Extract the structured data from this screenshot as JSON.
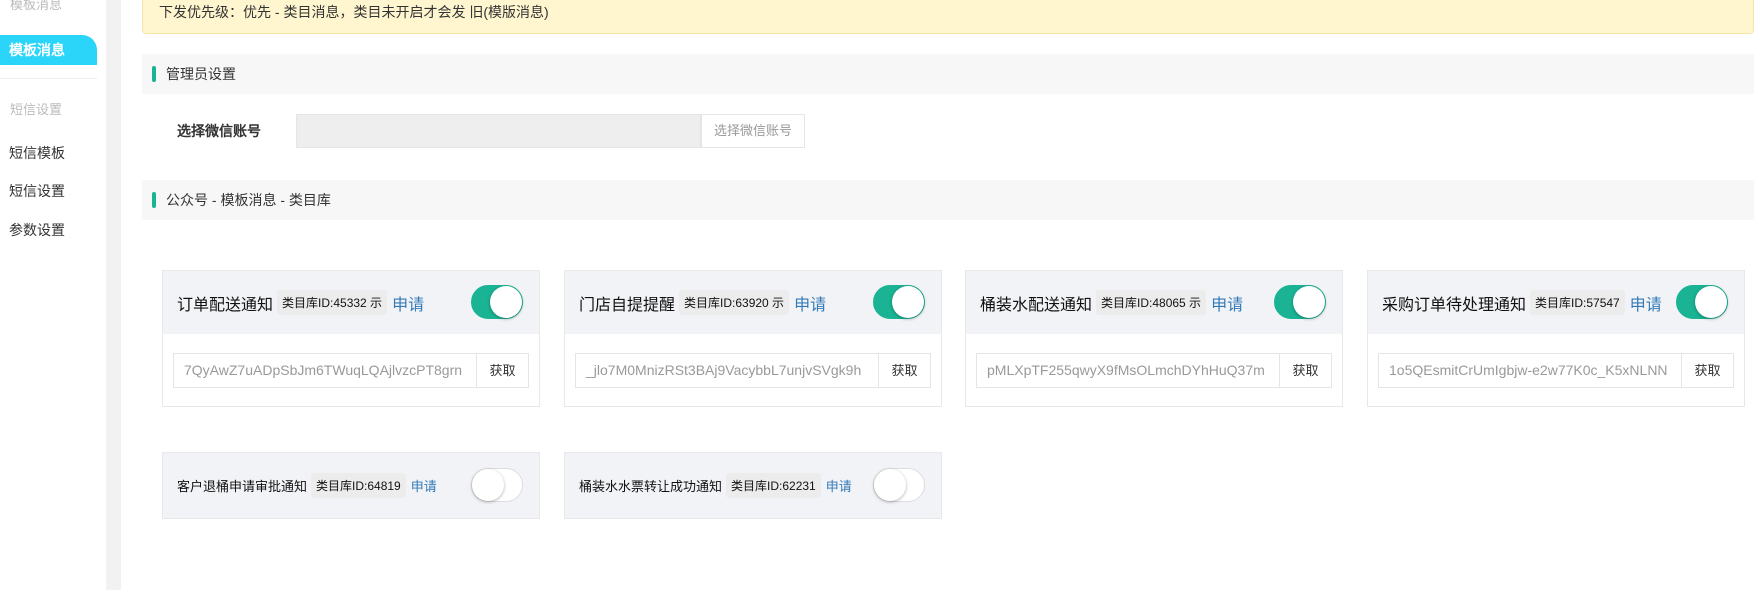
{
  "sidebar": {
    "group1_label": "模板消息",
    "active_item": "模板消息",
    "group2_label": "短信设置",
    "items": [
      {
        "label": "短信模板"
      },
      {
        "label": "短信设置"
      },
      {
        "label": "参数设置"
      }
    ]
  },
  "banner": {
    "text": "下发优先级：优先 - 类目消息，类目未开启才会发 旧(模版消息)"
  },
  "admin_section": {
    "title": "管理员设置",
    "select_label": "选择微信账号",
    "select_value": "",
    "select_button": "选择微信账号"
  },
  "category_section": {
    "title": "公众号 - 模板消息 - 类目库"
  },
  "accent_color": "#1ab394",
  "cards": [
    {
      "title": "订单配送通知",
      "badge": "类目库ID:45332 示",
      "apply": "申请",
      "enabled": true,
      "key": "7QyAwZ7uADpSbJm6TWuqLQAjlvzcPT8grn",
      "get": "获取"
    },
    {
      "title": "门店自提提醒",
      "badge": "类目库ID:63920 示",
      "apply": "申请",
      "enabled": true,
      "key": "_jlo7M0MnizRSt3BAj9VacybbL7unjvSVgk9h",
      "get": "获取"
    },
    {
      "title": "桶装水配送通知",
      "badge": "类目库ID:48065 示",
      "apply": "申请",
      "enabled": true,
      "key": "pMLXpTF255qwyX9fMsOLmchDYhHuQ37m",
      "get": "获取"
    },
    {
      "title": "采购订单待处理通知",
      "badge": "类目库ID:57547",
      "apply": "申请",
      "enabled": true,
      "key": "1o5QEsmitCrUmIgbjw-e2w77K0c_K5xNLNN",
      "get": "获取"
    },
    {
      "title": "客户退桶申请审批通知",
      "badge": "类目库ID:64819",
      "apply": "申请",
      "enabled": false
    },
    {
      "title": "桶装水水票转让成功通知",
      "badge": "类目库ID:62231",
      "apply": "申请",
      "enabled": false
    }
  ]
}
